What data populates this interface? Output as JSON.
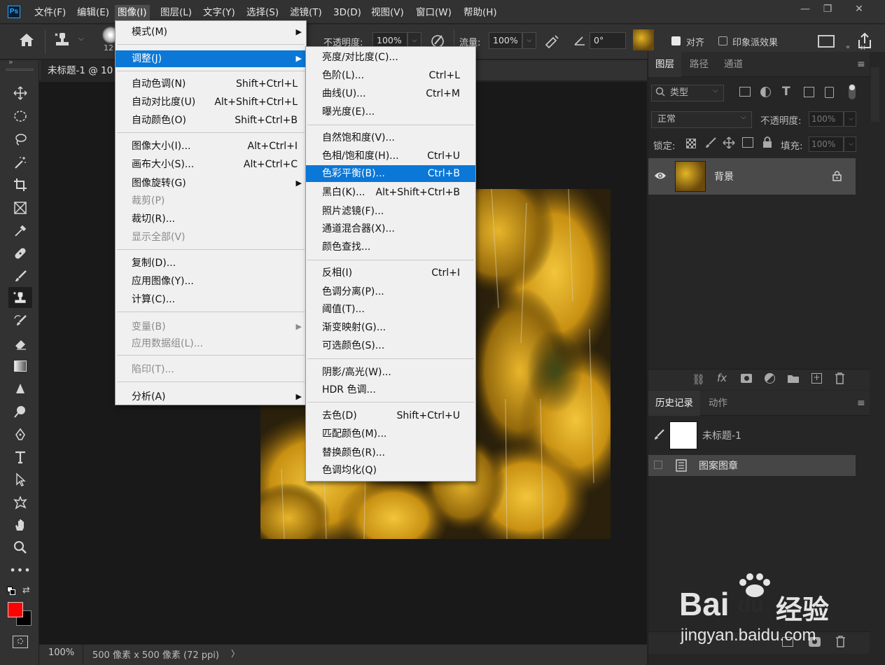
{
  "app": {
    "logo": "Ps"
  },
  "menubar": {
    "items": [
      "文件(F)",
      "编辑(E)",
      "图像(I)",
      "图层(L)",
      "文字(Y)",
      "选择(S)",
      "滤镜(T)",
      "3D(D)",
      "视图(V)",
      "窗口(W)",
      "帮助(H)"
    ],
    "active_index": 2
  },
  "window_controls": {
    "minimize": "—",
    "restore": "❐",
    "close": "✕"
  },
  "options": {
    "brush_size": "12",
    "opacity_label": "不透明度:",
    "opacity_value": "100%",
    "flow_label": "流量:",
    "flow_value": "100%",
    "angle_value": "0°",
    "align_label": "对齐",
    "impressionist_label": "印象派效果"
  },
  "document": {
    "tab_title": "未标题-1 @ 10",
    "zoom": "100%",
    "size_info": "500 像素 x 500 像素 (72 ppi)",
    "status_arrow": "〉"
  },
  "image_menu": {
    "items": [
      {
        "label": "模式(M)",
        "submenu": true
      },
      {
        "label": "调整(J)",
        "submenu": true,
        "highlight": true
      },
      {
        "label": "自动色调(N)",
        "shortcut": "Shift+Ctrl+L"
      },
      {
        "label": "自动对比度(U)",
        "shortcut": "Alt+Shift+Ctrl+L"
      },
      {
        "label": "自动颜色(O)",
        "shortcut": "Shift+Ctrl+B"
      },
      {
        "label": "图像大小(I)...",
        "shortcut": "Alt+Ctrl+I"
      },
      {
        "label": "画布大小(S)...",
        "shortcut": "Alt+Ctrl+C"
      },
      {
        "label": "图像旋转(G)",
        "submenu": true
      },
      {
        "label": "裁剪(P)",
        "disabled": true
      },
      {
        "label": "裁切(R)..."
      },
      {
        "label": "显示全部(V)",
        "disabled": true
      },
      {
        "label": "复制(D)..."
      },
      {
        "label": "应用图像(Y)..."
      },
      {
        "label": "计算(C)..."
      },
      {
        "label": "变量(B)",
        "submenu": true,
        "disabled": true
      },
      {
        "label": "应用数据组(L)...",
        "disabled": true
      },
      {
        "label": "陷印(T)...",
        "disabled": true
      },
      {
        "label": "分析(A)",
        "submenu": true
      }
    ]
  },
  "adjust_menu": {
    "items": [
      {
        "label": "亮度/对比度(C)..."
      },
      {
        "label": "色阶(L)...",
        "shortcut": "Ctrl+L"
      },
      {
        "label": "曲线(U)...",
        "shortcut": "Ctrl+M"
      },
      {
        "label": "曝光度(E)..."
      },
      {
        "label": "自然饱和度(V)..."
      },
      {
        "label": "色相/饱和度(H)...",
        "shortcut": "Ctrl+U"
      },
      {
        "label": "色彩平衡(B)...",
        "shortcut": "Ctrl+B",
        "highlight": true
      },
      {
        "label": "黑白(K)...",
        "shortcut": "Alt+Shift+Ctrl+B"
      },
      {
        "label": "照片滤镜(F)..."
      },
      {
        "label": "通道混合器(X)..."
      },
      {
        "label": "颜色查找..."
      },
      {
        "label": "反相(I)",
        "shortcut": "Ctrl+I"
      },
      {
        "label": "色调分离(P)..."
      },
      {
        "label": "阈值(T)..."
      },
      {
        "label": "渐变映射(G)..."
      },
      {
        "label": "可选颜色(S)..."
      },
      {
        "label": "阴影/高光(W)..."
      },
      {
        "label": "HDR 色调..."
      },
      {
        "label": "去色(D)",
        "shortcut": "Shift+Ctrl+U"
      },
      {
        "label": "匹配颜色(M)..."
      },
      {
        "label": "替换颜色(R)..."
      },
      {
        "label": "色调均化(Q)"
      }
    ]
  },
  "layers_panel": {
    "tabs": [
      "图层",
      "路径",
      "通道"
    ],
    "filter_placeholder": "类型",
    "blend_mode": "正常",
    "opacity_label": "不透明度:",
    "opacity_value": "100%",
    "lock_label": "锁定:",
    "fill_label": "填充:",
    "fill_value": "100%",
    "layer_name": "背景"
  },
  "history_panel": {
    "tabs": [
      "历史记录",
      "动作"
    ],
    "snapshot_name": "未标题-1",
    "step_name": "图案图章"
  },
  "colors": {
    "accent": "#0b77d6",
    "foreground": "#ff0000",
    "background": "#000000",
    "foliage": "#d9a514"
  },
  "watermark": {
    "brand": "Bai",
    "brand2": "du",
    "brand_cn": "经验",
    "url": "jingyan.baidu.com"
  }
}
